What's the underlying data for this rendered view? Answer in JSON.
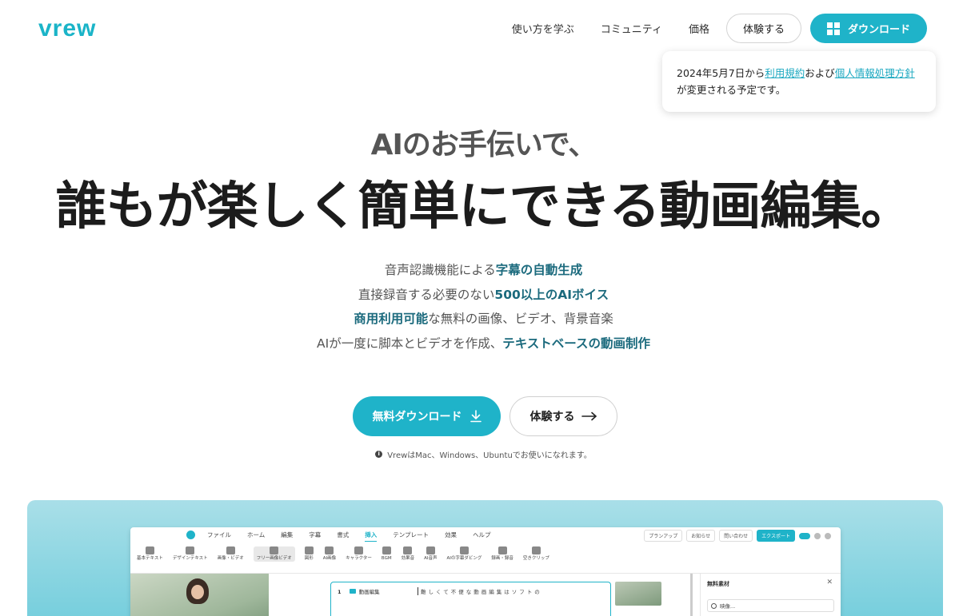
{
  "header": {
    "logo": "vrew",
    "nav": [
      "使い方を学ぶ",
      "コミュニティ",
      "価格"
    ],
    "trial_label": "体験する",
    "download_label": "ダウンロード"
  },
  "notice": {
    "prefix": "2024年5月7日から",
    "terms_link": "利用規約",
    "middle": "および",
    "privacy_link": "個人情報処理方針",
    "suffix": "が変更される予定です。"
  },
  "hero": {
    "subtitle": "AIのお手伝いで、",
    "title": "誰もが楽しく簡単にできる動画編集。",
    "features": [
      {
        "pre": "音声認識機能による",
        "strong": "字幕の自動生成",
        "post": ""
      },
      {
        "pre": "直接録音する必要のない",
        "strong": "500以上のAIボイス",
        "post": ""
      },
      {
        "pre": "",
        "strong": "商用利用可能",
        "post": "な無料の画像、ビデオ、背景音楽"
      },
      {
        "pre": "AIが一度に脚本とビデオを作成、",
        "strong": "テキストベースの動画制作",
        "post": ""
      }
    ],
    "free_download_label": "無料ダウンロード",
    "trial_label": "体験する",
    "platform_note": "VrewはMac、Windows、Ubuntuでお使いになれます。"
  },
  "app_preview": {
    "menu": [
      "ファイル",
      "ホーム",
      "編集",
      "字幕",
      "書式",
      "挿入",
      "テンプレート",
      "効果",
      "ヘルプ"
    ],
    "active_menu": "挿入",
    "right_buttons": [
      "プランアップ",
      "お知らせ",
      "問い合わせ"
    ],
    "export_label": "エクスポート",
    "tools": [
      "基本テキスト",
      "デザインテキスト",
      "画像・ビデオ",
      "フリー画像ビデオ",
      "図形",
      "AI画像",
      "キャラクター",
      "BGM",
      "効果音",
      "AI音声",
      "AIの字幕ダビング",
      "録画・録音",
      "空きクリップ"
    ],
    "clip_number": "1",
    "clip_name": "動画編集",
    "clip_text": "難しくて不便な動画編集はソフトの",
    "panel_title": "無料素材",
    "panel_search": "映像..."
  },
  "colors": {
    "accent": "#1fb3c9",
    "feature_strong": "#1b6a7d"
  }
}
